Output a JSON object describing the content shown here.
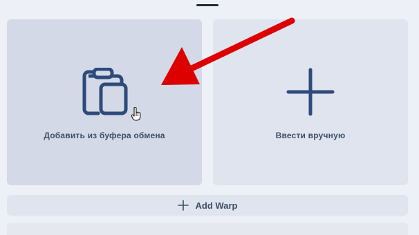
{
  "cards": {
    "clipboard": {
      "label": "Добавить из буфера обмена",
      "icon": "clipboard-icon"
    },
    "manual": {
      "label": "Ввести вручную",
      "icon": "plus-icon"
    }
  },
  "add_bar": {
    "label": "Add Warp",
    "icon": "plus-icon"
  },
  "colors": {
    "icon": "#2e4a7a",
    "text": "#3c4e66",
    "annotation_arrow": "#dd0000"
  }
}
